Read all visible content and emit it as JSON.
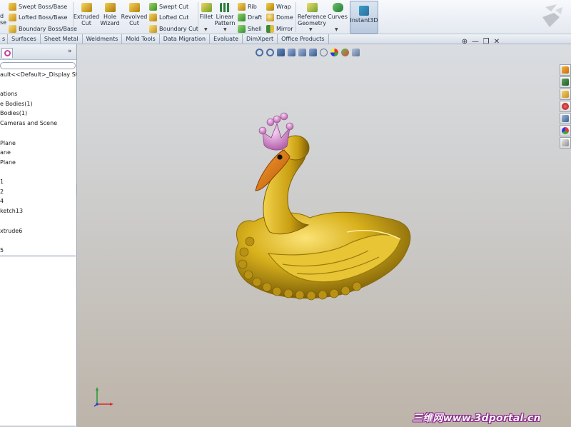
{
  "ribbon": {
    "extrude_group": {
      "partial_label_line1": "d",
      "partial_label_line2": "se",
      "swept_boss": "Swept Boss/Base",
      "lofted_boss": "Lofted Boss/Base",
      "boundary_boss": "Boundary Boss/Base"
    },
    "extruded_cut": [
      "Extruded",
      "Cut"
    ],
    "hole_wizard": [
      "Hole",
      "Wizard"
    ],
    "revolved_cut": [
      "Revolved",
      "Cut"
    ],
    "swept_cut": "Swept Cut",
    "lofted_cut": "Lofted Cut",
    "boundary_cut": "Boundary Cut",
    "fillet": "Fillet",
    "linear_pattern": [
      "Linear",
      "Pattern"
    ],
    "rib": "Rib",
    "draft": "Draft",
    "shell": "Shell",
    "wrap": "Wrap",
    "dome": "Dome",
    "mirror": "Mirror",
    "reference_geometry": [
      "Reference",
      "Geometry"
    ],
    "curves": "Curves",
    "instant3d": "Instant3D"
  },
  "tabs": [
    {
      "label": "s"
    },
    {
      "label": "Surfaces"
    },
    {
      "label": "Sheet Metal"
    },
    {
      "label": "Weldments"
    },
    {
      "label": "Mold Tools"
    },
    {
      "label": "Data Migration"
    },
    {
      "label": "Evaluate"
    },
    {
      "label": "DimXpert"
    },
    {
      "label": "Office Products"
    }
  ],
  "left_panel": {
    "more_chevron": "»",
    "tree": [
      {
        "label": "ault<<Default>_Display Sta"
      },
      {
        "label": "ations"
      },
      {
        "label": "e Bodies(1)"
      },
      {
        "label": "Bodies(1)"
      },
      {
        "label": "Cameras and Scene"
      },
      {
        "label": "Plane"
      },
      {
        "label": "ane"
      },
      {
        "label": "Plane"
      },
      {
        "label": "1"
      },
      {
        "label": "2"
      },
      {
        "label": "4"
      },
      {
        "label": "ketch13"
      },
      {
        "label": "xtrude6"
      },
      {
        "label": "5"
      }
    ]
  },
  "viewport": {
    "window_controls": [
      "⊕",
      "—",
      "❐",
      "✕"
    ],
    "watermark": "三维网www.3dportal.cn",
    "model_colors": {
      "body": "#d8b01c",
      "beak": "#e07a12",
      "crown": "#e7a2df"
    }
  },
  "icons": {
    "task_pane": [
      "home-icon",
      "design-library-icon",
      "file-explorer-icon",
      "search-icon",
      "view-palette-icon",
      "appearances-icon",
      "custom-properties-icon"
    ],
    "view_toolbar": [
      "zoom-to-fit-icon",
      "zoom-to-area-icon",
      "previous-view-icon",
      "section-view-icon",
      "view-orientation-icon",
      "display-style-icon",
      "hide-show-icon",
      "edit-appearance-icon",
      "apply-scene-icon",
      "view-settings-icon"
    ]
  }
}
